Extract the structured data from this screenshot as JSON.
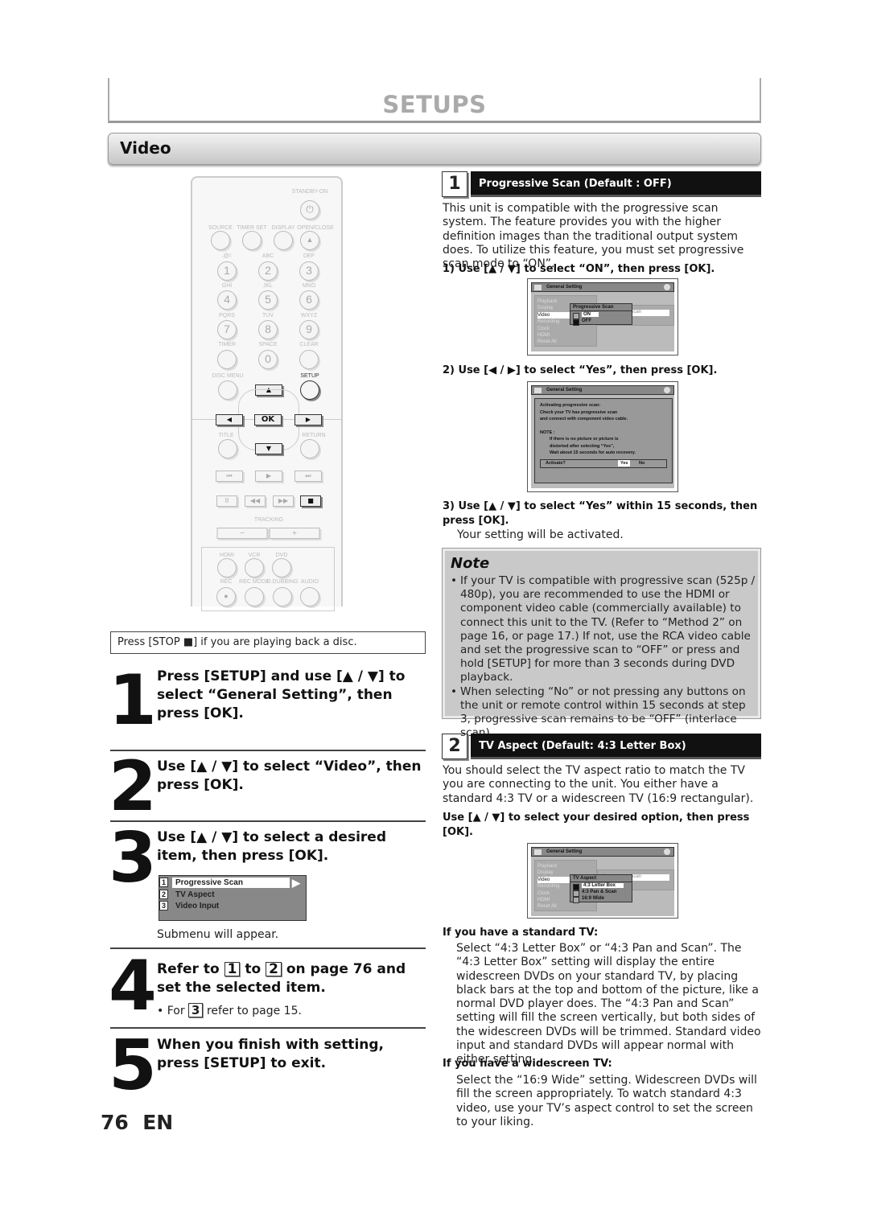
{
  "header": {
    "title": "SETUPS",
    "section": "Video"
  },
  "remote": {
    "standby": "STANDBY-ON",
    "top_labels": [
      "SOURCE",
      "TIMER SET",
      "DISPLAY",
      "OPEN/CLOSE"
    ],
    "digit_labels": [
      ".@/:",
      "ABC",
      "DEF",
      "GHI",
      "JKL",
      "MNO",
      "PQRS",
      "TUV",
      "WXYZ",
      "TIMER",
      "SPACE",
      "CLEAR"
    ],
    "digits": [
      "1",
      "2",
      "3",
      "4",
      "5",
      "6",
      "7",
      "8",
      "9",
      "0"
    ],
    "disc_menu": "DISC MENU",
    "setup": "SETUP",
    "ok": "OK",
    "title": "TITLE",
    "return": "RETURN",
    "tracking": "TRACKING",
    "minus": "−",
    "plus": "+",
    "bottom_labels": [
      "HDMI",
      "VCR",
      "DVD"
    ],
    "bottom_labels2": [
      "REC",
      "REC MODE",
      "D.DUBBING",
      "AUDIO"
    ]
  },
  "stop_note": "Press [STOP ■] if you are playing back a disc.",
  "steps": [
    {
      "num": "1",
      "text": "Press [SETUP] and use [▲ / ▼] to select “General Setting”, then press [OK]."
    },
    {
      "num": "2",
      "text": "Use [▲ / ▼] to select “Video”, then press [OK]."
    },
    {
      "num": "3",
      "text": "Use [▲ / ▼] to select a desired item, then press [OK].",
      "submenu": [
        {
          "n": "1",
          "label": "Progressive Scan"
        },
        {
          "n": "2",
          "label": "TV Aspect"
        },
        {
          "n": "3",
          "label": "Video Input"
        }
      ],
      "after": "Submenu will appear."
    },
    {
      "num": "4",
      "text_a": "Refer to",
      "k1": "1",
      "text_b": "to",
      "k2": "2",
      "text_c": "on page 76 and set the selected item.",
      "sub_a": "• For",
      "k3": "3",
      "sub_b": "refer to page 15."
    },
    {
      "num": "5",
      "text": "When you finish with setting, press [SETUP] to exit."
    }
  ],
  "footer": {
    "page": "76",
    "lang": "EN"
  },
  "section1": {
    "num": "1",
    "title": "Progressive Scan (Default : OFF)",
    "intro": "This unit is compatible with the progressive scan system. The feature provides you with the higher definition images than the traditional output system does. To utilize this feature, you must set progressive scan mode to “ON”.",
    "step1": "1) Use [▲ / ▼] to select “ON”, then press [OK].",
    "step2": "2) Use [◀ / ▶] to select “Yes”, then press [OK].",
    "step3": "3) Use [▲ / ▼] to select “Yes” within 15 seconds, then press [OK].",
    "step3_result": "Your setting will be activated.",
    "screen1": {
      "title": "General Setting",
      "menu": [
        "Playback",
        "Display",
        "Video",
        "Recording",
        "Clock",
        "HDMI",
        "Reset All"
      ],
      "item": "Progressive Scan",
      "sub_title": "Progressive Scan",
      "options": [
        "ON",
        "OFF"
      ]
    },
    "screen2": {
      "title": "General Setting",
      "l1": "Activating progressive scan:",
      "l2": "Check your TV has progressive scan",
      "l3": "and connect with component video cable.",
      "note": "NOTE :",
      "n1": "If there is no picture or picture is",
      "n2": "distorted after selecting    “Yes”,",
      "n3": "Wait about 15 seconds for auto recovery.",
      "ask": "Activate?",
      "yes": "Yes",
      "no": "No"
    }
  },
  "note": {
    "title": "Note",
    "items": [
      "If your TV is compatible with progressive scan (525p / 480p), you are recommended to use the HDMI or component video cable (commercially available) to connect this unit to the TV. (Refer to “Method 2” on page 16, or page 17.) If not, use the RCA video cable and set the progressive scan to “OFF” or press and hold [SETUP] for more than 3 seconds during DVD playback.",
      "When selecting “No” or not pressing any buttons on the unit or remote control within 15 seconds at step 3, progressive scan remains to be “OFF” (interlace scan)."
    ]
  },
  "section2": {
    "num": "2",
    "title": "TV Aspect (Default: 4:3 Letter Box)",
    "intro": "You should select the TV aspect ratio to match the TV you are connecting to the unit. You either have a standard 4:3 TV or a widescreen TV (16:9 rectangular).",
    "instruction": "Use [▲ / ▼] to select your desired option, then press [OK].",
    "screen": {
      "title": "General Setting",
      "menu": [
        "Playback",
        "Display",
        "Video",
        "Recording",
        "Clock",
        "HDMI",
        "Reset All"
      ],
      "item": "Progressive Scan",
      "sub_title": "TV Aspect",
      "options": [
        "4:3 Letter Box",
        "4:3 Pan & Scan",
        "16:9 Wide"
      ]
    },
    "standard_heading": "If you have a standard TV:",
    "standard_text": "Select “4:3 Letter Box” or “4:3 Pan and Scan”. The “4:3 Letter Box” setting will display the entire widescreen DVDs on your standard TV, by placing black bars at the top and bottom of the picture, like a normal DVD player does. The “4:3 Pan and Scan” setting will fill the screen vertically, but both sides of the widescreen DVDs will be trimmed. Standard video input and standard DVDs will appear normal with either setting.",
    "wide_heading": "If you have a widescreen TV:",
    "wide_text": "Select the “16:9 Wide” setting. Widescreen DVDs will fill the screen appropriately. To watch standard 4:3 video, use your TV’s aspect control to set the screen to your liking."
  }
}
